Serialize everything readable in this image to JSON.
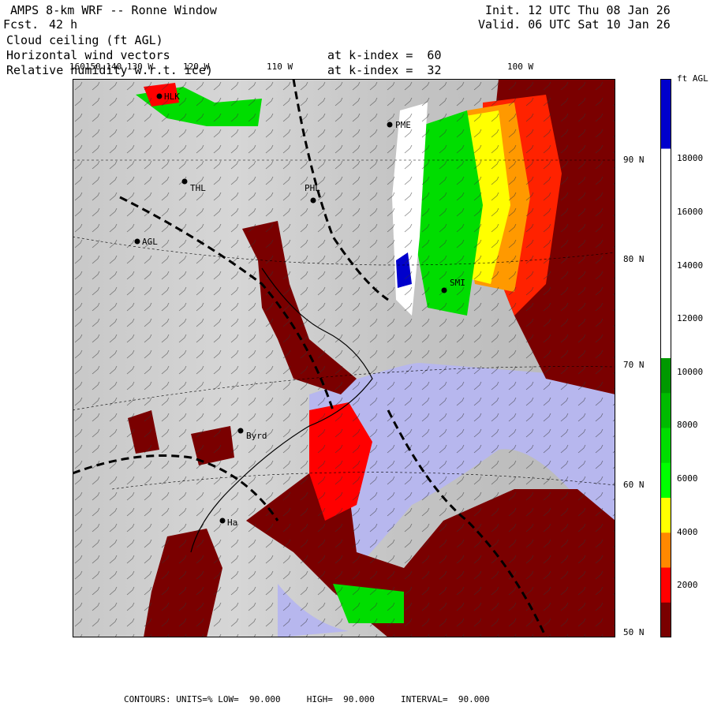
{
  "header": {
    "model_line": " AMPS 8-km WRF -- Ronne Window",
    "fcst_label": "Fcst.",
    "fcst_value": "42 h",
    "init_line": "Init. 12 UTC Thu 08 Jan 26",
    "valid_line": "Valid. 06 UTC Sat 10 Jan 26",
    "field1": "Cloud ceiling (ft AGL)",
    "field2": "Horizontal wind vectors",
    "field3": "Relative humidity w.r.t. ice)",
    "k1": "at k-index =  60",
    "k2": "at k-index =  32"
  },
  "map": {
    "stations": [
      "HLK",
      "PME",
      "THL",
      "PHL",
      "AGL",
      "SMI",
      "Byrd",
      "Ha"
    ],
    "lat_labels": [
      "90 N",
      "80 N",
      "70 N",
      "60 N",
      "50 N"
    ],
    "lon_labels": [
      "160150 140 130 W",
      "120 W",
      "110 W",
      "100 W"
    ]
  },
  "colorbar": {
    "unit": "ft AGL",
    "labels": [
      "18000",
      "16000",
      "14000",
      "12000",
      "10000",
      "8000",
      "6000",
      "4000",
      "2000"
    ],
    "colors": [
      "#0000cc",
      "#0000cc",
      "#ffffff",
      "#ffffff",
      "#ffffff",
      "#ffffff",
      "#ffffff",
      "#ffffff",
      "#009900",
      "#00bb00",
      "#00dd00",
      "#00ff00",
      "#ffff00",
      "#ff8800",
      "#ff0000",
      "#7a0000"
    ]
  },
  "footer": {
    "text": "CONTOURS: UNITS=% LOW=  90.000     HIGH=  90.000     INTERVAL=  90.000"
  }
}
